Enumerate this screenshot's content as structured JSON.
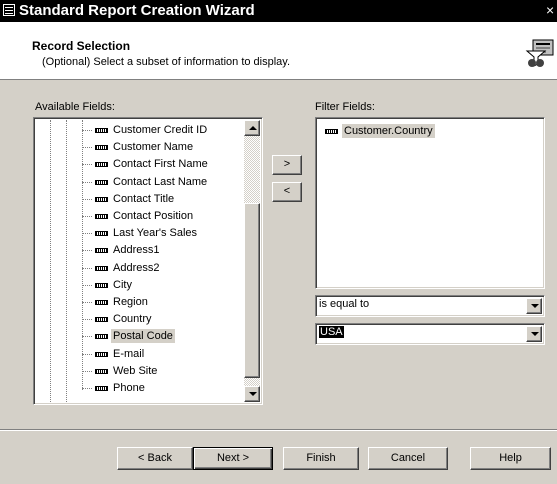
{
  "window": {
    "title": "Standard Report Creation Wizard",
    "close_glyph": "×"
  },
  "header": {
    "title": "Record Selection",
    "subtitle": "(Optional)  Select a subset of information to display.",
    "icon": "filter-wizard-icon"
  },
  "available": {
    "label": "Available Fields:",
    "items": [
      "Customer Credit ID",
      "Customer Name",
      "Contact First Name",
      "Contact Last Name",
      "Contact Title",
      "Contact Position",
      "Last Year's Sales",
      "Address1",
      "Address2",
      "City",
      "Region",
      "Country",
      "Postal Code",
      "E-mail",
      "Web Site",
      "Phone"
    ],
    "selected": "Postal Code"
  },
  "move": {
    "add_label": ">",
    "remove_label": "<"
  },
  "filter": {
    "label": "Filter Fields:",
    "items": [
      "Customer.Country"
    ],
    "operator": "is equal to",
    "value": "USA"
  },
  "buttons": {
    "back": "< Back",
    "next": "Next >",
    "finish": "Finish",
    "cancel": "Cancel",
    "help": "Help"
  }
}
